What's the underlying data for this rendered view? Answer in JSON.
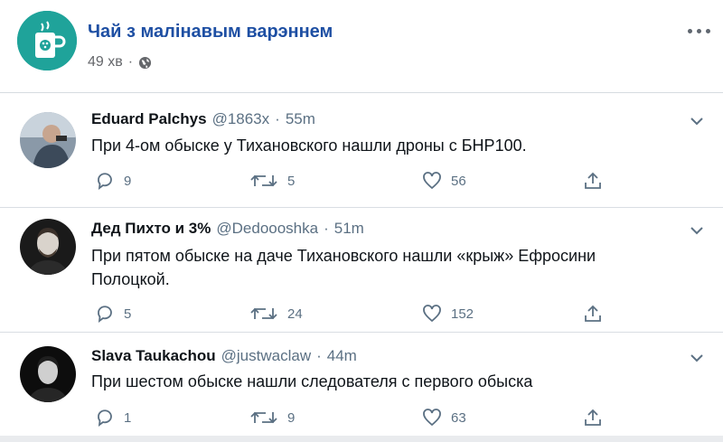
{
  "post": {
    "page_name": "Чай з малінавым варэннем",
    "time": "49 хв",
    "separator": "·"
  },
  "tweets": [
    {
      "name": "Eduard Palchys",
      "handle": "@1863x",
      "dot": "·",
      "time": "55m",
      "text": "При 4-ом обыске у Тихановского нашли дроны с БНР100.",
      "replies": "9",
      "retweets": "5",
      "likes": "56"
    },
    {
      "name": "Дед Пихто и 3%",
      "handle": "@Dedoooshka",
      "dot": "·",
      "time": "51m",
      "text": "При пятом обыске на даче Тихановского нашли «крыж» Ефросини Полоцкой.",
      "replies": "5",
      "retweets": "24",
      "likes": "152"
    },
    {
      "name": "Slava Taukachou",
      "handle": "@justwaclaw",
      "dot": "·",
      "time": "44m",
      "text": "При шестом обыске нашли следователя с первого обыска",
      "replies": "1",
      "retweets": "9",
      "likes": "63"
    }
  ],
  "icons": {
    "page_avatar": "mug-icon",
    "privacy": "globe-icon",
    "more": "more-options-icon",
    "reply": "reply-icon",
    "retweet": "retweet-icon",
    "like": "heart-icon",
    "share": "share-icon",
    "caret": "chevron-down-icon"
  },
  "colors": {
    "page_name": "#1e4fa3",
    "page_avatar_bg": "#1fa39a",
    "secondary_text": "#5b7083"
  }
}
